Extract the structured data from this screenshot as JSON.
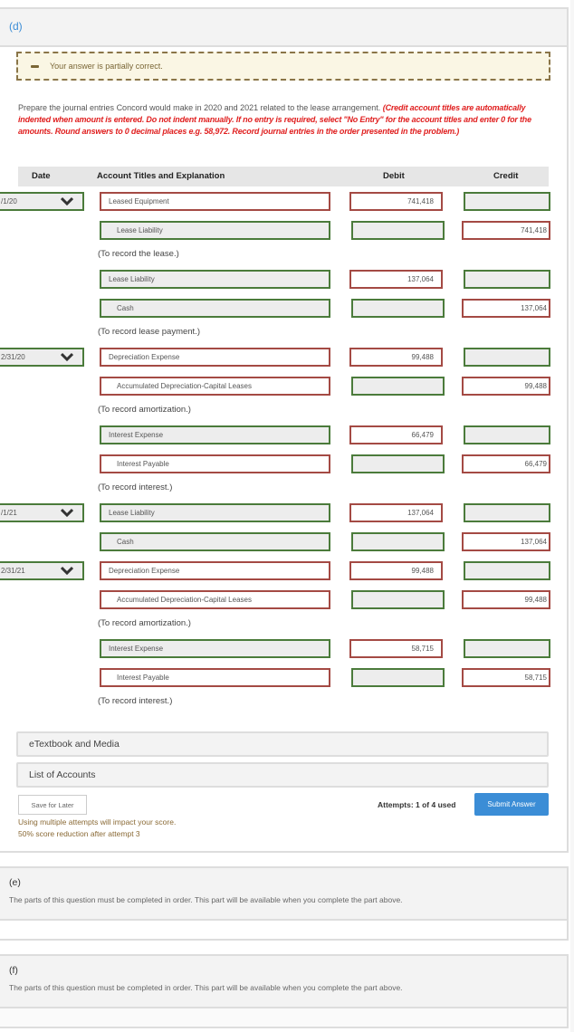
{
  "part_d": {
    "label": "(d)",
    "feedback": "Your answer is partially correct.",
    "instructions_plain": "Prepare the journal entries Concord would make in 2020 and 2021 related to the lease arrangement. ",
    "instructions_red": "(Credit account titles are automatically indented when amount is entered. Do not indent manually. If no entry is required, select \"No Entry\" for the account titles and enter 0 for the amounts. Round answers to 0 decimal places e.g. 58,972. Record journal entries in the order presented in the problem.)",
    "table_headers": {
      "date": "Date",
      "account": "Account Titles and Explanation",
      "debit": "Debit",
      "credit": "Credit"
    },
    "dates": [
      "/1/20",
      "2/31/20",
      "/1/21",
      "2/31/21"
    ],
    "rows": [
      {
        "account": "Leased Equipment",
        "debit": "741,418",
        "credit": ""
      },
      {
        "account": "Lease Liability",
        "debit": "",
        "credit": "741,418"
      },
      {
        "account": "Lease Liability",
        "debit": "137,064",
        "credit": ""
      },
      {
        "account": "Cash",
        "debit": "",
        "credit": "137,064"
      },
      {
        "account": "Depreciation Expense",
        "debit": "99,488",
        "credit": ""
      },
      {
        "account": "Accumulated Depreciation-Capital Leases",
        "debit": "",
        "credit": "99,488"
      },
      {
        "account": "Interest Expense",
        "debit": "66,479",
        "credit": ""
      },
      {
        "account": "Interest Payable",
        "debit": "",
        "credit": "66,479"
      },
      {
        "account": "Lease Liability",
        "debit": "137,064",
        "credit": ""
      },
      {
        "account": "Cash",
        "debit": "",
        "credit": "137,064"
      },
      {
        "account": "Depreciation Expense",
        "debit": "99,488",
        "credit": ""
      },
      {
        "account": "Accumulated Depreciation-Capital Leases",
        "debit": "",
        "credit": "99,488"
      },
      {
        "account": "Interest Expense",
        "debit": "58,715",
        "credit": ""
      },
      {
        "account": "Interest Payable",
        "debit": "",
        "credit": "58,715"
      }
    ],
    "explanations": [
      "(To record the lease.)",
      "(To record lease payment.)",
      "(To record amortization.)",
      "(To record interest.)",
      "(To record amortization.)",
      "(To record interest.)"
    ],
    "etextbook_label": "eTextbook and Media",
    "list_accounts_label": "List of Accounts",
    "save_label": "Save for Later",
    "attempts_text": "Attempts: 1 of 4 used",
    "submit_label": "Submit Answer",
    "warning_line1": "Using multiple attempts will impact your score.",
    "warning_line2": "50% score reduction after attempt 3"
  },
  "part_e": {
    "label": "(e)",
    "message": "The parts of this question must be completed in order. This part will be available when you complete the part above."
  },
  "part_f": {
    "label": "(f)",
    "message": "The parts of this question must be completed in order. This part will be available when you complete the part above."
  },
  "colors": {
    "correct_border": "#4b7b3b",
    "incorrect_border": "#a44a44",
    "accent_blue": "#3b8dd6",
    "instruction_red": "#e02020"
  }
}
